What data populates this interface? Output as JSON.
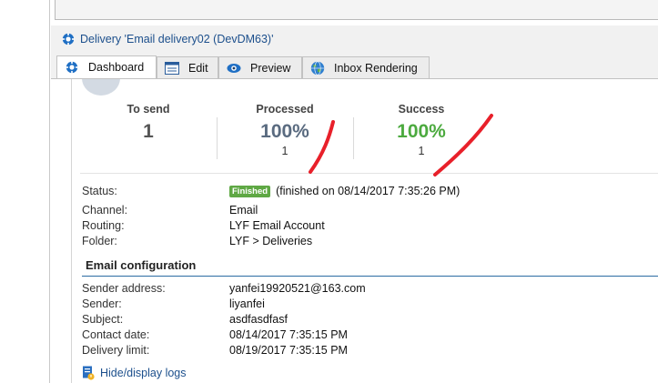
{
  "window": {
    "title": "Delivery 'Email delivery02 (DevDM63)'"
  },
  "tabs": [
    {
      "label": "Dashboard",
      "icon": "dashboard-icon",
      "active": true
    },
    {
      "label": "Edit",
      "icon": "edit-icon",
      "active": false
    },
    {
      "label": "Preview",
      "icon": "eye-icon",
      "active": false
    },
    {
      "label": "Inbox Rendering",
      "icon": "globe-icon",
      "active": false
    }
  ],
  "kpis": {
    "to_send": {
      "label": "To send",
      "value": "1"
    },
    "processed": {
      "label": "Processed",
      "value": "100%",
      "count": "1"
    },
    "success": {
      "label": "Success",
      "value": "100%",
      "count": "1"
    }
  },
  "details": {
    "status_label": "Status:",
    "status_badge": "Finished",
    "status_text": "(finished on 08/14/2017 7:35:26 PM)",
    "channel_label": "Channel:",
    "channel_value": "Email",
    "routing_label": "Routing:",
    "routing_value": "LYF Email Account",
    "folder_label": "Folder:",
    "folder_value": "LYF > Deliveries"
  },
  "email_config": {
    "heading": "Email configuration",
    "sender_address_label": "Sender address:",
    "sender_address_value": "yanfei19920521@163.com",
    "sender_label": "Sender:",
    "sender_value": "liyanfei",
    "subject_label": "Subject:",
    "subject_value": "asdfasdfasf",
    "contact_date_label": "Contact date:",
    "contact_date_value": "08/14/2017 7:35:15 PM",
    "delivery_limit_label": "Delivery limit:",
    "delivery_limit_value": "08/19/2017 7:35:15 PM"
  },
  "logs": {
    "label": "Hide/display logs"
  },
  "colors": {
    "link": "#1c4f8c",
    "success": "#4caa3f",
    "badge": "#5fa844",
    "annotation": "#e8202a"
  }
}
